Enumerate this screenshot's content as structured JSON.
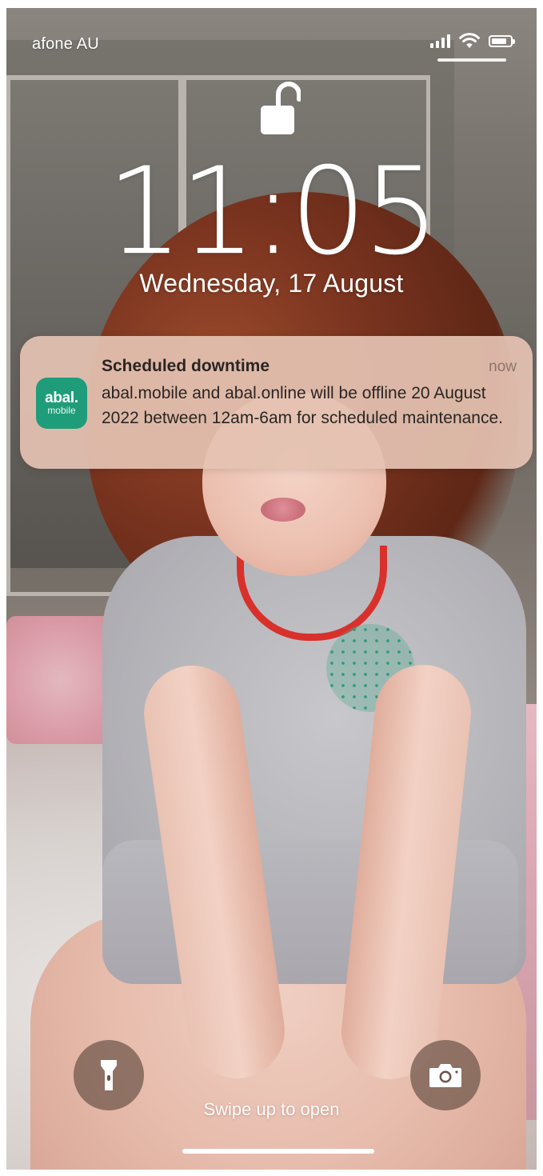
{
  "status_bar": {
    "carrier": "afone AU",
    "icons": [
      "signal-icon",
      "wifi-icon",
      "battery-icon"
    ]
  },
  "lock_screen": {
    "time": "11:05",
    "date": "Wednesday, 17 August",
    "lock_icon": "unlocked-padlock-icon"
  },
  "notification": {
    "app_icon": {
      "brand": "abal.",
      "sub": "mobile"
    },
    "title": "Scheduled downtime",
    "time": "now",
    "body": "abal.mobile and abal.online will be offline 20 August 2022 between 12am-6am for scheduled maintenance."
  },
  "bottom": {
    "left_button_icon": "flashlight-icon",
    "right_button_icon": "camera-icon",
    "swipe_hint": "Swipe up to open"
  },
  "colors": {
    "app_icon_green": "#1f9d7a",
    "notification_bg": "#e4c2b2",
    "text_dark": "#2a2522"
  }
}
